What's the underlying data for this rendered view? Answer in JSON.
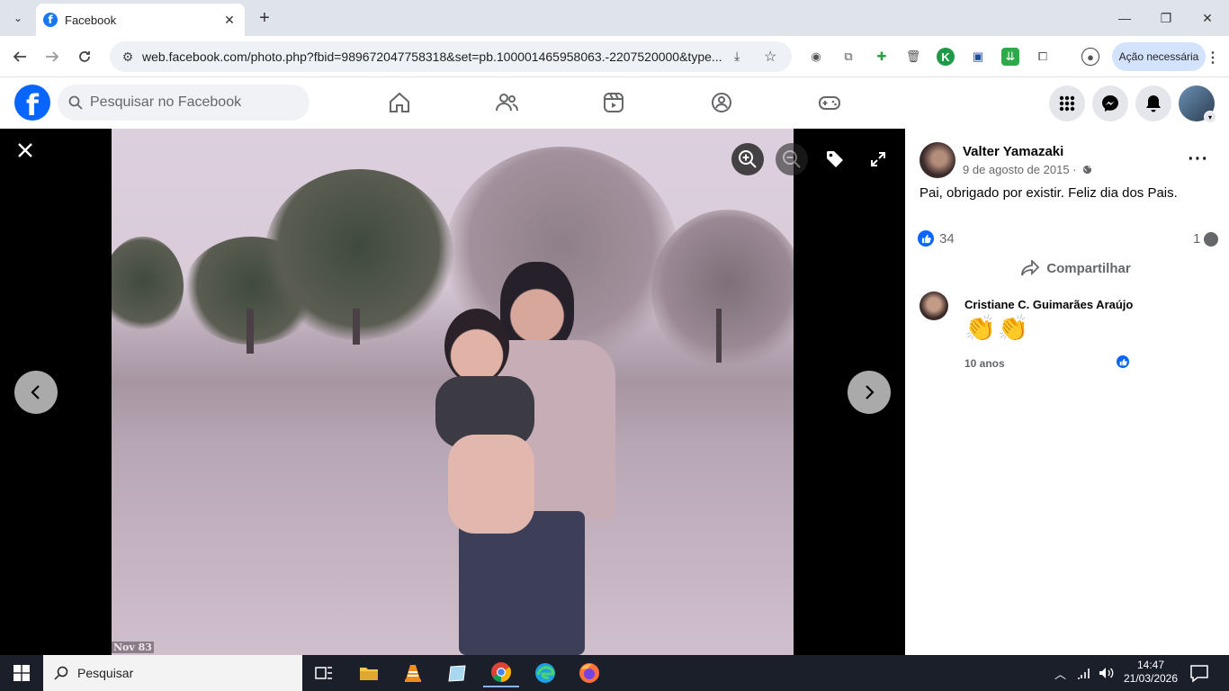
{
  "browser": {
    "tab_title": "Facebook",
    "url": "web.facebook.com/photo.php?fbid=989672047758318&set=pb.100001465958063.-2207520000&type...",
    "action_needed_label": "Ação necessária"
  },
  "facebook": {
    "search_placeholder": "Pesquisar no Facebook",
    "logo_letter": "f"
  },
  "photo": {
    "date_stamp": "Nov 83"
  },
  "post": {
    "author_name": "Valter Yamazaki",
    "date": "9 de agosto de 2015 ·",
    "caption": "Pai, obrigado por existir. Feliz dia dos Pais.",
    "like_count": "34",
    "comment_count": "1",
    "share_label": "Compartilhar"
  },
  "comment": {
    "author_name": "Cristiane C. Guimarães Araújo",
    "content": "👏👏",
    "time": "10 anos"
  },
  "taskbar": {
    "search_placeholder": "Pesquisar",
    "time": "14:47",
    "date": "21/03/2026"
  },
  "colors": {
    "facebook_blue": "#0866ff",
    "chrome_action_pill": "#d3e3fd",
    "taskbar_bg": "#1b1f2a"
  }
}
